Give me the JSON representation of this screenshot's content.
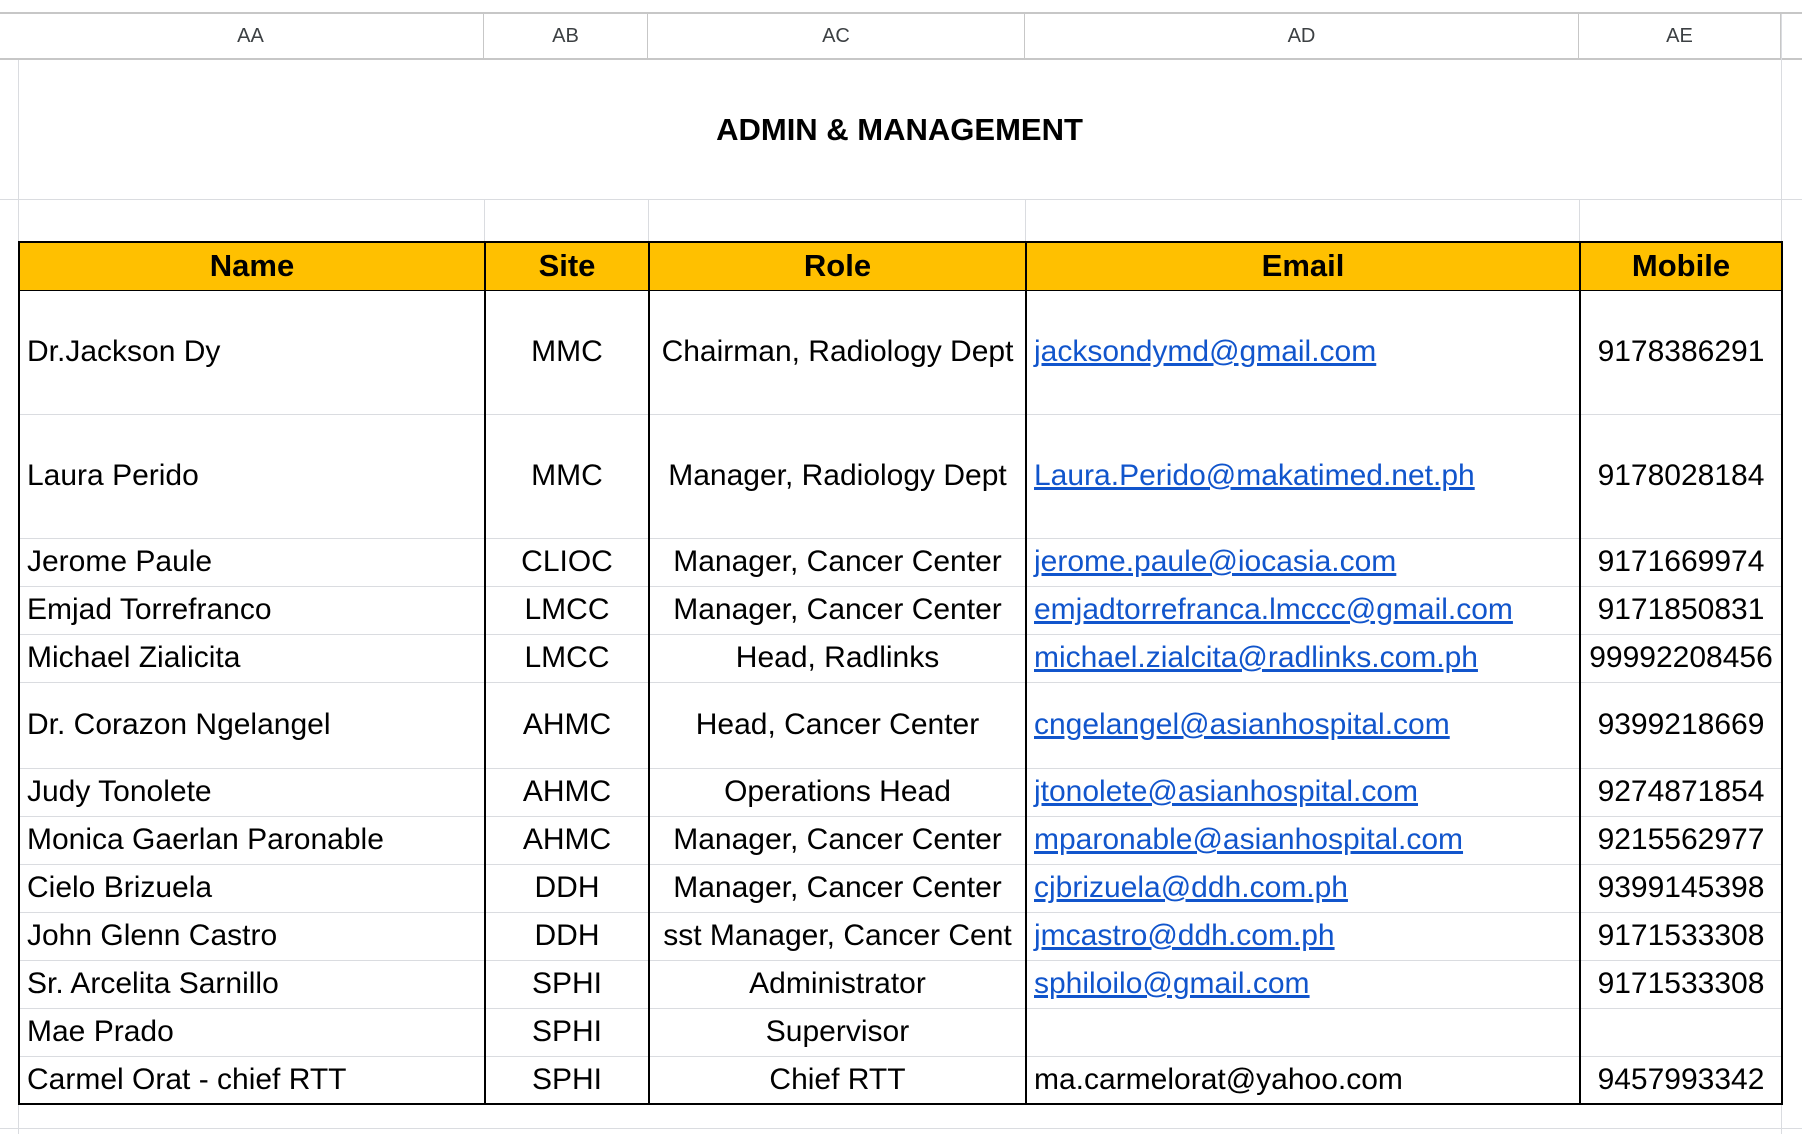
{
  "columns": [
    "AA",
    "AB",
    "AC",
    "AD",
    "AE"
  ],
  "title": "ADMIN & MANAGEMENT",
  "table": {
    "headers": {
      "name": "Name",
      "site": "Site",
      "role": "Role",
      "email": "Email",
      "mobile": "Mobile"
    },
    "rows": [
      {
        "name": "Dr.Jackson Dy",
        "site": "MMC",
        "role": "Chairman, Radiology Dept",
        "email": "jacksondymd@gmail.com",
        "email_link": true,
        "mobile": "9178386291"
      },
      {
        "name": "Laura Perido",
        "site": "MMC",
        "role": "Manager, Radiology Dept",
        "email": "Laura.Perido@makatimed.net.ph",
        "email_link": true,
        "mobile": "9178028184"
      },
      {
        "name": "Jerome Paule",
        "site": "CLIOC",
        "role": "Manager, Cancer Center",
        "email": "jerome.paule@iocasia.com",
        "email_link": true,
        "mobile": "9171669974"
      },
      {
        "name": "Emjad Torrefranco",
        "site": "LMCC",
        "role": "Manager, Cancer Center",
        "email": "emjadtorrefranca.lmccc@gmail.com",
        "email_link": true,
        "mobile": "9171850831"
      },
      {
        "name": "Michael Zialicita",
        "site": "LMCC",
        "role": "Head, Radlinks",
        "email": "michael.zialcita@radlinks.com.ph",
        "email_link": true,
        "mobile": "99992208456"
      },
      {
        "name": "Dr. Corazon Ngelangel",
        "site": "AHMC",
        "role": "Head, Cancer Center",
        "email": "cngelangel@asianhospital.com",
        "email_link": true,
        "mobile": "9399218669"
      },
      {
        "name": "Judy Tonolete",
        "site": "AHMC",
        "role": "Operations Head",
        "email": "jtonolete@asianhospital.com",
        "email_link": true,
        "mobile": "9274871854"
      },
      {
        "name": "Monica Gaerlan Paronable",
        "site": "AHMC",
        "role": "Manager, Cancer Center",
        "email": "mparonable@asianhospital.com",
        "email_link": true,
        "mobile": "9215562977"
      },
      {
        "name": "Cielo Brizuela",
        "site": "DDH",
        "role": "Manager, Cancer Center",
        "email": "cjbrizuela@ddh.com.ph",
        "email_link": true,
        "mobile": "9399145398"
      },
      {
        "name": "John Glenn Castro",
        "site": "DDH",
        "role": "sst Manager, Cancer Cent",
        "email": "jmcastro@ddh.com.ph",
        "email_link": true,
        "mobile": "9171533308"
      },
      {
        "name": "Sr. Arcelita Sarnillo",
        "site": "SPHI",
        "role": "Administrator",
        "email": "sphiloilo@gmail.com",
        "email_link": true,
        "mobile": "9171533308"
      },
      {
        "name": "Mae Prado",
        "site": "SPHI",
        "role": "Supervisor",
        "email": "",
        "email_link": false,
        "mobile": ""
      },
      {
        "name": "Carmel Orat - chief RTT",
        "site": "SPHI",
        "role": "Chief RTT",
        "email": "ma.carmelorat@yahoo.com",
        "email_link": false,
        "mobile": "9457993342"
      }
    ]
  }
}
